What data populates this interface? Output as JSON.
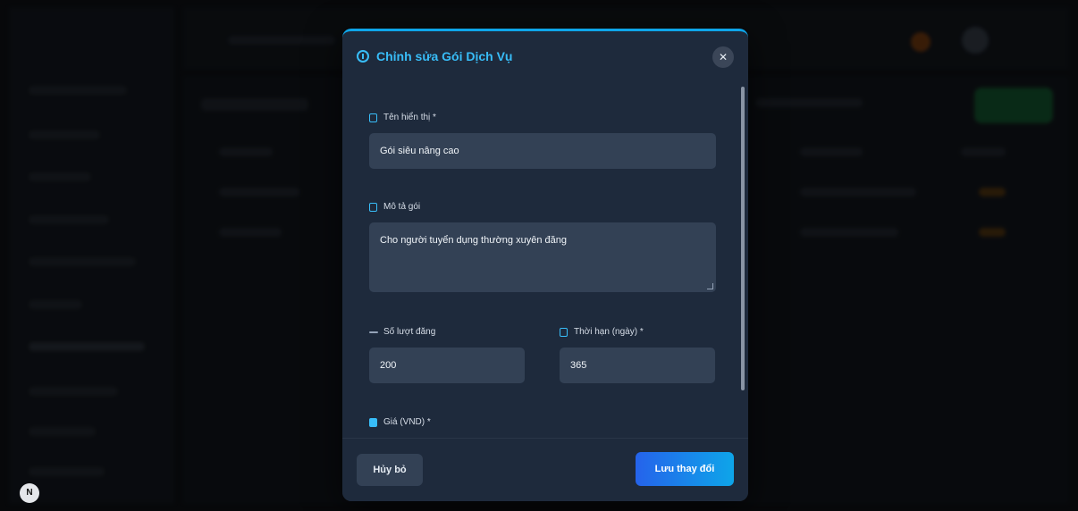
{
  "modal": {
    "title": "Chỉnh sửa Gói Dịch Vụ",
    "close_label": "✕",
    "fields": {
      "name": {
        "label": "Tên hiển thị *",
        "value": "Gói siêu nâng cao"
      },
      "description": {
        "label": "Mô tả gói",
        "value": "Cho người tuyển dụng thường xuyên đăng"
      },
      "posts": {
        "label": "Số lượt đăng",
        "value": "200"
      },
      "duration": {
        "label": "Thời hạn (ngày) *",
        "value": "365"
      },
      "price": {
        "label": "Giá (VND) *"
      }
    },
    "cancel_label": "Hủy bỏ",
    "save_label": "Lưu thay đổi"
  },
  "badge": "N",
  "colors": {
    "accent": "#38bdf8",
    "modal_bg": "#1e2a3c",
    "input_bg": "#334155",
    "primary_button": "#2563eb"
  }
}
